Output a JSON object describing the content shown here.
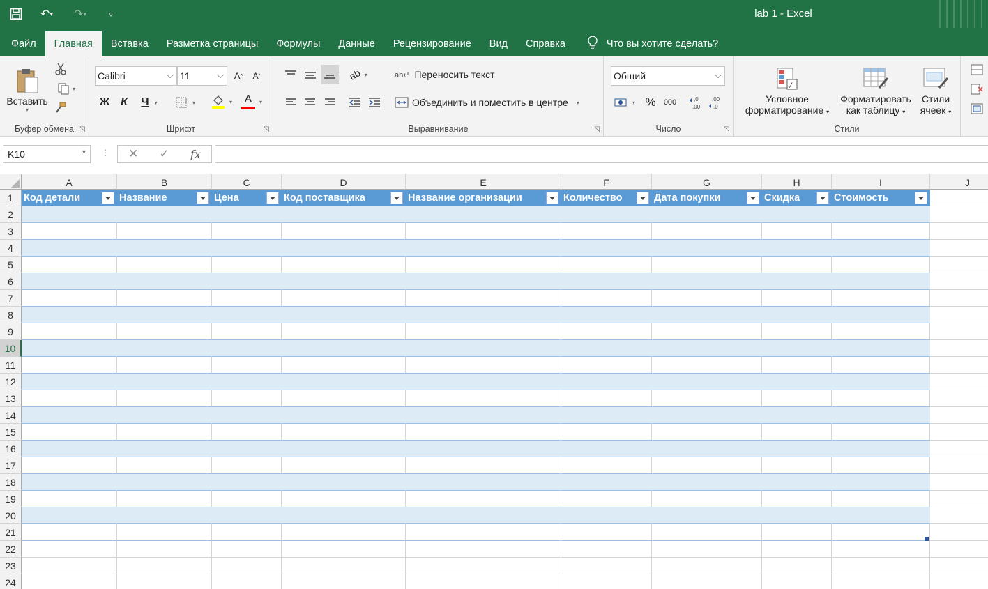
{
  "titlebar": {
    "title": "lab 1  -  Excel"
  },
  "menu": {
    "tabs": [
      "Файл",
      "Главная",
      "Вставка",
      "Разметка страницы",
      "Формулы",
      "Данные",
      "Рецензирование",
      "Вид",
      "Справка"
    ],
    "active_tab": "Главная",
    "tell_me": "Что вы хотите сделать?"
  },
  "ribbon": {
    "clipboard": {
      "paste_label": "Вставить",
      "group_label": "Буфер обмена"
    },
    "font": {
      "name": "Calibri",
      "size": "11",
      "grow": "A",
      "shrink": "A",
      "bold": "Ж",
      "italic": "К",
      "underline": "Ч",
      "font_color_letter": "A",
      "group_label": "Шрифт"
    },
    "alignment": {
      "wrap_text": "Переносить текст",
      "merge_center": "Объединить и поместить в центре",
      "group_label": "Выравнивание"
    },
    "number": {
      "format": "Общий",
      "percent": "%",
      "thousands": "000",
      "group_label": "Число"
    },
    "styles": {
      "conditional_line1": "Условное",
      "conditional_line2": "форматирование",
      "table_line1": "Форматировать",
      "table_line2": "как таблицу",
      "cell_line1": "Стили",
      "cell_line2": "ячеек",
      "group_label": "Стили"
    }
  },
  "formula_bar": {
    "name_box": "K10",
    "fx": "fx",
    "value": ""
  },
  "grid": {
    "columns": [
      "A",
      "B",
      "C",
      "D",
      "E",
      "F",
      "G",
      "H",
      "I",
      "J"
    ],
    "rows": [
      "1",
      "2",
      "3",
      "4",
      "5",
      "6",
      "7",
      "8",
      "9",
      "10",
      "11",
      "12",
      "13",
      "14",
      "15",
      "16",
      "17",
      "18",
      "19",
      "20",
      "21",
      "22",
      "23",
      "24"
    ],
    "active_row": "10",
    "table_headers": [
      "Код детали",
      "Название",
      "Цена",
      "Код поставщика",
      "Название организации",
      "Количество",
      "Дата покупки",
      "Скидка",
      "Стоимость"
    ]
  },
  "colors": {
    "excel_green": "#217346",
    "table_header": "#5b9bd5",
    "table_band": "#ddebf7"
  }
}
